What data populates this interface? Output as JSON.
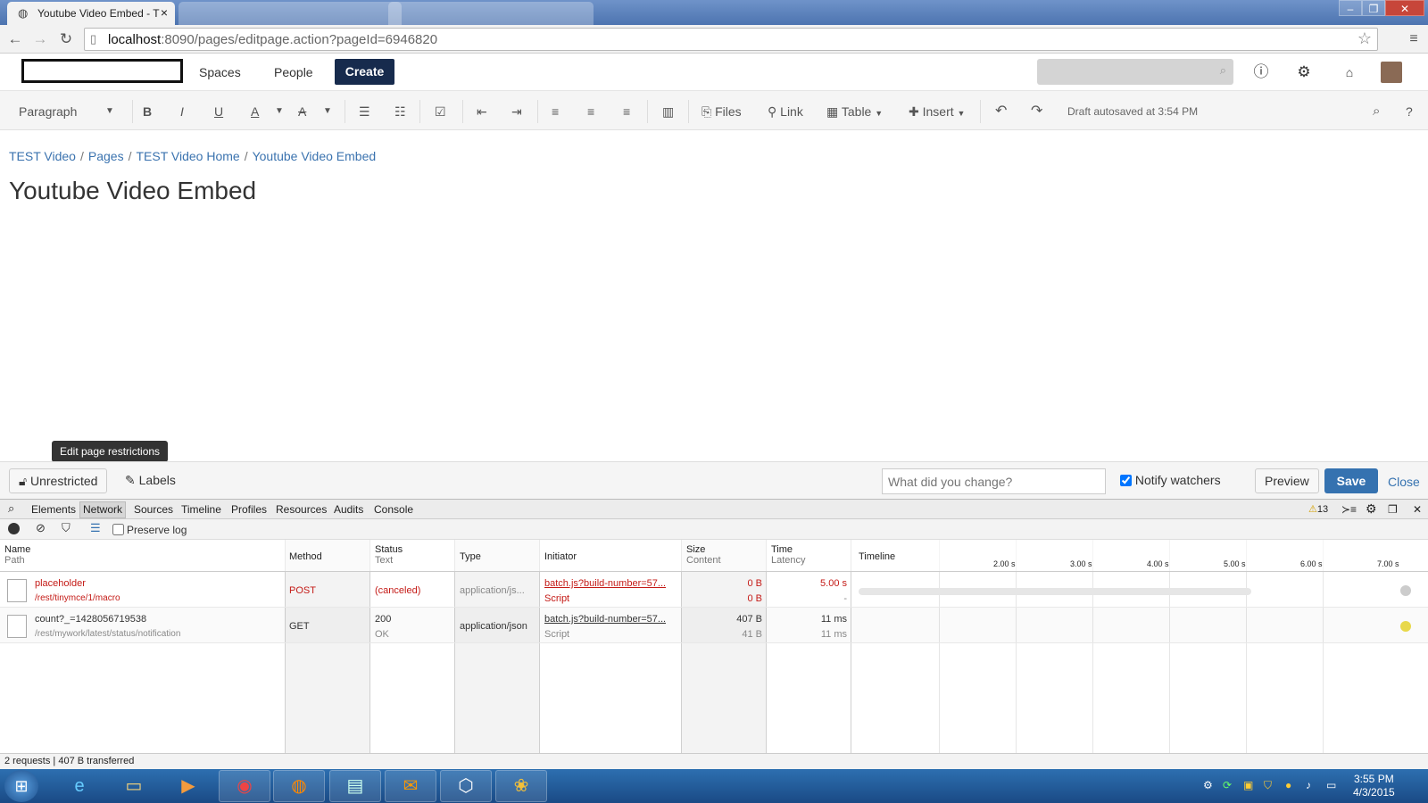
{
  "browser": {
    "tabs": [
      {
        "title": "Youtube Video Embed - T",
        "close": "×"
      }
    ],
    "url_host": "localhost",
    "url_rest": ":8090/pages/editpage.action?pageId=6946820",
    "icons": [
      "back-icon",
      "forward-icon",
      "reload-icon",
      "page-icon",
      "star-icon",
      "menu-icon"
    ]
  },
  "header": {
    "nav": [
      "Spaces",
      "People"
    ],
    "create": "Create",
    "icons": [
      "search-icon",
      "help-icon",
      "gear-icon",
      "notification-icon",
      "avatar"
    ]
  },
  "editor_toolbar": {
    "paragraph": "Paragraph",
    "bold": "B",
    "italic": "I",
    "underline": "U",
    "text_color": "A",
    "format": "A",
    "files": "Files",
    "link": "Link",
    "table": "Table",
    "insert": "Insert",
    "draft": "Draft autosaved at 3:54 PM",
    "help": "?"
  },
  "breadcrumb": [
    "TEST Video",
    "Pages",
    "TEST Video Home",
    "Youtube Video Embed"
  ],
  "page_title": "Youtube Video Embed",
  "tooltip": "Edit page restrictions",
  "footer": {
    "restrictions": "Unrestricted",
    "labels": "Labels",
    "comment_placeholder": "What did you change?",
    "notify": "Notify watchers",
    "preview": "Preview",
    "save": "Save",
    "close": "Close"
  },
  "devtools": {
    "tabs": [
      "Elements",
      "Network",
      "Sources",
      "Timeline",
      "Profiles",
      "Resources",
      "Audits",
      "Console"
    ],
    "active_tab": "Network",
    "warnings": "13",
    "preserve_log": "Preserve log",
    "columns": {
      "name": "Name",
      "path": "Path",
      "method": "Method",
      "status": "Status",
      "text": "Text",
      "type": "Type",
      "initiator": "Initiator",
      "size": "Size",
      "content": "Content",
      "time": "Time",
      "latency": "Latency",
      "timeline": "Timeline"
    },
    "timeline_ticks": [
      "2.00 s",
      "3.00 s",
      "4.00 s",
      "5.00 s",
      "6.00 s",
      "7.00 s"
    ],
    "rows": [
      {
        "name": "placeholder",
        "path": "/rest/tinymce/1/macro",
        "method": "POST",
        "status": "(canceled)",
        "status_text": "",
        "type": "application/js...",
        "initiator": "batch.js?build-number=57...",
        "initiator_type": "Script",
        "size": "0 B",
        "content": "0 B",
        "time": "5.00 s",
        "latency": "-"
      },
      {
        "name": "count?_=1428056719538",
        "path": "/rest/mywork/latest/status/notification",
        "method": "GET",
        "status": "200",
        "status_text": "OK",
        "type": "application/json",
        "initiator": "batch.js?build-number=57...",
        "initiator_type": "Script",
        "size": "407 B",
        "content": "41 B",
        "time": "11 ms",
        "latency": "11 ms"
      }
    ],
    "summary": "2 requests | 407 B transferred"
  },
  "taskbar": {
    "time": "3:55 PM",
    "date": "4/3/2015"
  },
  "colors": {
    "accent": "#3572b0",
    "create": "#172b4d",
    "link": "#3b73af",
    "error": "#c41a16"
  }
}
